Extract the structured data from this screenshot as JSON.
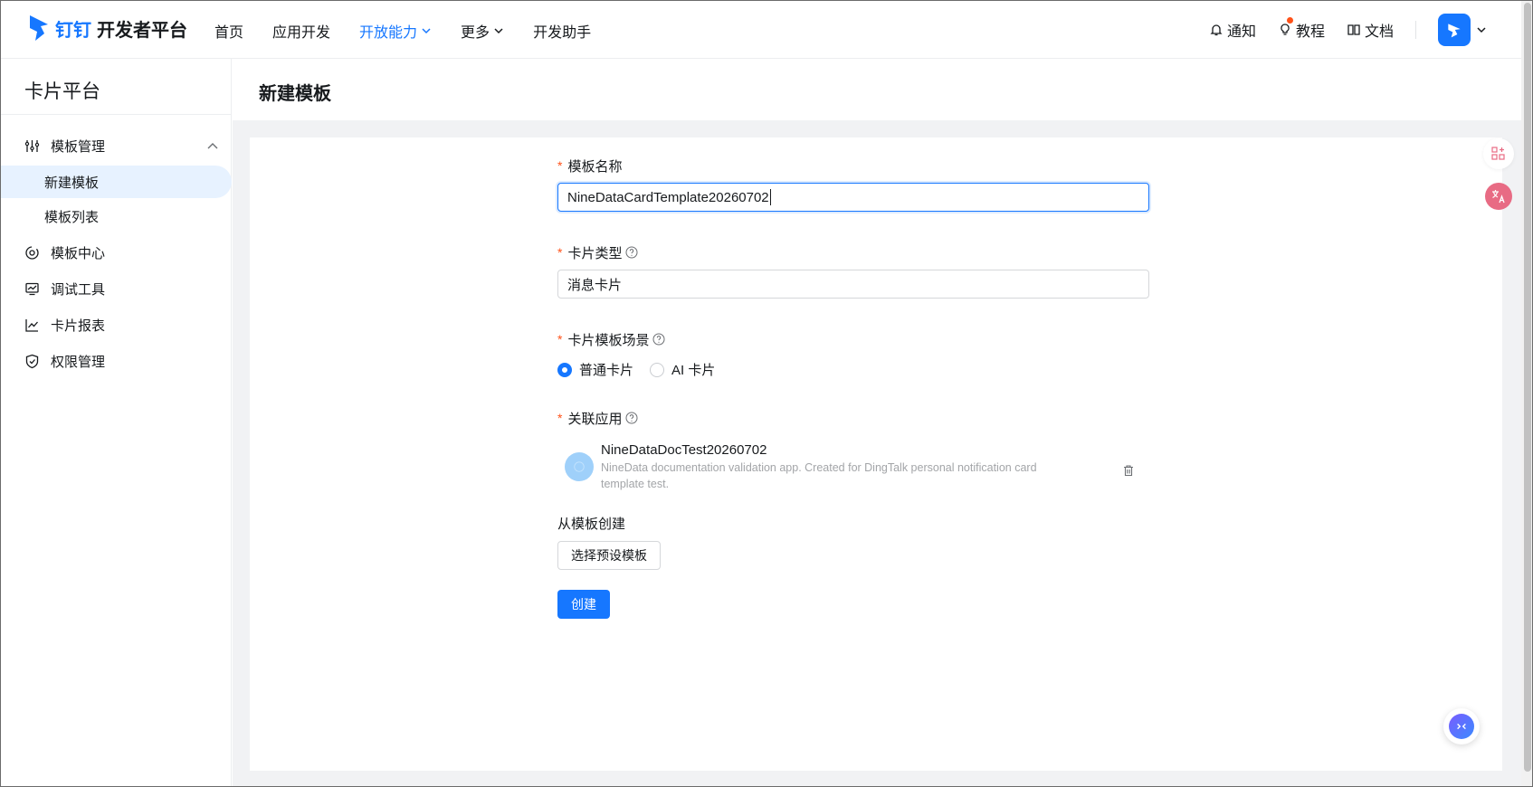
{
  "brand": {
    "name": "钉钉",
    "product": "开发者平台",
    "color": "#1677ff"
  },
  "nav": [
    {
      "label": "首页",
      "active": false,
      "has_menu": false
    },
    {
      "label": "应用开发",
      "active": false,
      "has_menu": false
    },
    {
      "label": "开放能力",
      "active": true,
      "has_menu": true
    },
    {
      "label": "更多",
      "active": false,
      "has_menu": true
    },
    {
      "label": "开发助手",
      "active": false,
      "has_menu": false
    }
  ],
  "right_nav": {
    "notify": "通知",
    "tutorial": "教程",
    "docs": "文档"
  },
  "sidebar": {
    "title": "卡片平台",
    "group": {
      "label": "模板管理",
      "icon": "sliders-icon",
      "expanded": true
    },
    "sub_items": [
      {
        "label": "新建模板",
        "active": true
      },
      {
        "label": "模板列表",
        "active": false
      }
    ],
    "items": [
      {
        "label": "模板中心",
        "icon": "template-center-icon"
      },
      {
        "label": "调试工具",
        "icon": "monitor-icon"
      },
      {
        "label": "卡片报表",
        "icon": "line-chart-icon"
      },
      {
        "label": "权限管理",
        "icon": "shield-icon"
      }
    ]
  },
  "page": {
    "title": "新建模板"
  },
  "form": {
    "name": {
      "label": "模板名称",
      "value": "NineDataCardTemplate20260702"
    },
    "card_type": {
      "label": "卡片类型",
      "value": "消息卡片"
    },
    "scene": {
      "label": "卡片模板场景",
      "options": [
        {
          "label": "普通卡片",
          "checked": true
        },
        {
          "label": "AI 卡片",
          "checked": false
        }
      ]
    },
    "app": {
      "label": "关联应用",
      "name": "NineDataDocTest20260702",
      "description": "NineData documentation validation app. Created for DingTalk personal notification card template test."
    },
    "from_template": {
      "label": "从模板创建",
      "button": "选择预设模板"
    },
    "submit": "创建"
  }
}
